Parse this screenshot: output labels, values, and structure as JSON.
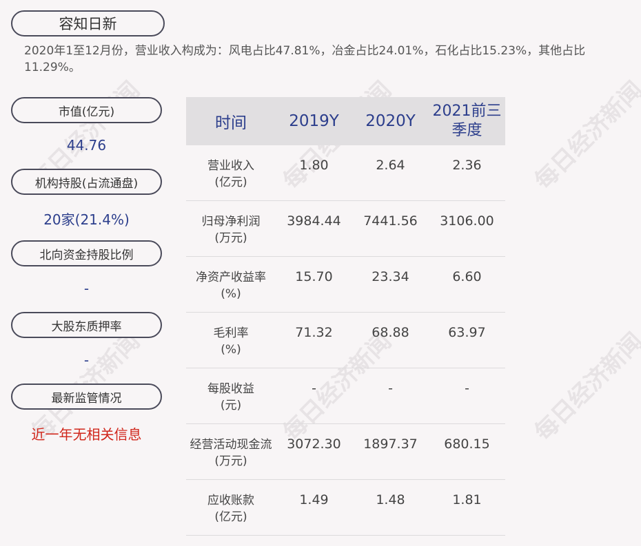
{
  "title": "容知日新",
  "summary": "2020年1至12月份，营业收入构成为：风电占比47.81%，冶金占比24.01%，石化占比15.23%，其他占比11.29%。",
  "sidebar": [
    {
      "label": "市值(亿元)",
      "value": "44.76",
      "color": "#2c3e8c"
    },
    {
      "label": "机构持股(占流通盘)",
      "value": "20家(21.4%)",
      "color": "#2c3e8c"
    },
    {
      "label": "北向资金持股比例",
      "value": "-",
      "color": "#2c3e8c"
    },
    {
      "label": "大股东质押率",
      "value": "-",
      "color": "#2c3e8c"
    },
    {
      "label": "最新监管情况",
      "value": "近一年无相关信息",
      "color": "#d0261b"
    }
  ],
  "table": {
    "headers": [
      "时间",
      "2019Y",
      "2020Y",
      "2021前三季度"
    ],
    "rows": [
      {
        "label": "营业收入\n(亿元)",
        "values": [
          "1.80",
          "2.64",
          "2.36"
        ]
      },
      {
        "label": "归母净利润\n(万元)",
        "values": [
          "3984.44",
          "7441.56",
          "3106.00"
        ]
      },
      {
        "label": "净资产收益率\n(%)",
        "values": [
          "15.70",
          "23.34",
          "6.60"
        ]
      },
      {
        "label": "毛利率\n(%)",
        "values": [
          "71.32",
          "68.88",
          "63.97"
        ]
      },
      {
        "label": "每股收益\n(元)",
        "values": [
          "-",
          "-",
          "-"
        ]
      },
      {
        "label": "经营活动现金流\n(万元)",
        "values": [
          "3072.30",
          "1897.37",
          "680.15"
        ]
      },
      {
        "label": "应收账款\n(亿元)",
        "values": [
          "1.49",
          "1.48",
          "1.81"
        ]
      }
    ]
  },
  "watermark": "每日经济新闻"
}
